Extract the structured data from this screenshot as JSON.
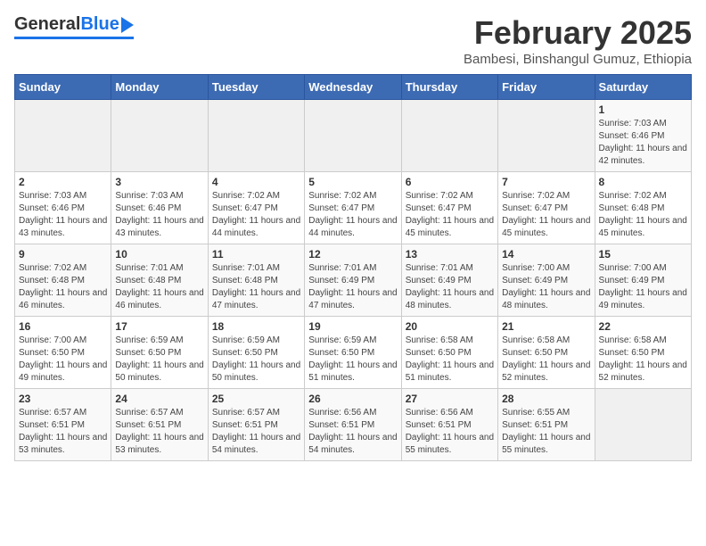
{
  "header": {
    "logo_general": "General",
    "logo_blue": "Blue",
    "month_title": "February 2025",
    "subtitle": "Bambesi, Binshangul Gumuz, Ethiopia"
  },
  "calendar": {
    "days_of_week": [
      "Sunday",
      "Monday",
      "Tuesday",
      "Wednesday",
      "Thursday",
      "Friday",
      "Saturday"
    ],
    "weeks": [
      {
        "row_bg": "odd",
        "days": [
          {
            "date": "",
            "info": "",
            "empty": true
          },
          {
            "date": "",
            "info": "",
            "empty": true
          },
          {
            "date": "",
            "info": "",
            "empty": true
          },
          {
            "date": "",
            "info": "",
            "empty": true
          },
          {
            "date": "",
            "info": "",
            "empty": true
          },
          {
            "date": "",
            "info": "",
            "empty": true
          },
          {
            "date": "1",
            "info": "Sunrise: 7:03 AM\nSunset: 6:46 PM\nDaylight: 11 hours and 42 minutes."
          }
        ]
      },
      {
        "row_bg": "even",
        "days": [
          {
            "date": "2",
            "info": "Sunrise: 7:03 AM\nSunset: 6:46 PM\nDaylight: 11 hours and 43 minutes."
          },
          {
            "date": "3",
            "info": "Sunrise: 7:03 AM\nSunset: 6:46 PM\nDaylight: 11 hours and 43 minutes."
          },
          {
            "date": "4",
            "info": "Sunrise: 7:02 AM\nSunset: 6:47 PM\nDaylight: 11 hours and 44 minutes."
          },
          {
            "date": "5",
            "info": "Sunrise: 7:02 AM\nSunset: 6:47 PM\nDaylight: 11 hours and 44 minutes."
          },
          {
            "date": "6",
            "info": "Sunrise: 7:02 AM\nSunset: 6:47 PM\nDaylight: 11 hours and 45 minutes."
          },
          {
            "date": "7",
            "info": "Sunrise: 7:02 AM\nSunset: 6:47 PM\nDaylight: 11 hours and 45 minutes."
          },
          {
            "date": "8",
            "info": "Sunrise: 7:02 AM\nSunset: 6:48 PM\nDaylight: 11 hours and 45 minutes."
          }
        ]
      },
      {
        "row_bg": "odd",
        "days": [
          {
            "date": "9",
            "info": "Sunrise: 7:02 AM\nSunset: 6:48 PM\nDaylight: 11 hours and 46 minutes."
          },
          {
            "date": "10",
            "info": "Sunrise: 7:01 AM\nSunset: 6:48 PM\nDaylight: 11 hours and 46 minutes."
          },
          {
            "date": "11",
            "info": "Sunrise: 7:01 AM\nSunset: 6:48 PM\nDaylight: 11 hours and 47 minutes."
          },
          {
            "date": "12",
            "info": "Sunrise: 7:01 AM\nSunset: 6:49 PM\nDaylight: 11 hours and 47 minutes."
          },
          {
            "date": "13",
            "info": "Sunrise: 7:01 AM\nSunset: 6:49 PM\nDaylight: 11 hours and 48 minutes."
          },
          {
            "date": "14",
            "info": "Sunrise: 7:00 AM\nSunset: 6:49 PM\nDaylight: 11 hours and 48 minutes."
          },
          {
            "date": "15",
            "info": "Sunrise: 7:00 AM\nSunset: 6:49 PM\nDaylight: 11 hours and 49 minutes."
          }
        ]
      },
      {
        "row_bg": "even",
        "days": [
          {
            "date": "16",
            "info": "Sunrise: 7:00 AM\nSunset: 6:50 PM\nDaylight: 11 hours and 49 minutes."
          },
          {
            "date": "17",
            "info": "Sunrise: 6:59 AM\nSunset: 6:50 PM\nDaylight: 11 hours and 50 minutes."
          },
          {
            "date": "18",
            "info": "Sunrise: 6:59 AM\nSunset: 6:50 PM\nDaylight: 11 hours and 50 minutes."
          },
          {
            "date": "19",
            "info": "Sunrise: 6:59 AM\nSunset: 6:50 PM\nDaylight: 11 hours and 51 minutes."
          },
          {
            "date": "20",
            "info": "Sunrise: 6:58 AM\nSunset: 6:50 PM\nDaylight: 11 hours and 51 minutes."
          },
          {
            "date": "21",
            "info": "Sunrise: 6:58 AM\nSunset: 6:50 PM\nDaylight: 11 hours and 52 minutes."
          },
          {
            "date": "22",
            "info": "Sunrise: 6:58 AM\nSunset: 6:50 PM\nDaylight: 11 hours and 52 minutes."
          }
        ]
      },
      {
        "row_bg": "odd",
        "days": [
          {
            "date": "23",
            "info": "Sunrise: 6:57 AM\nSunset: 6:51 PM\nDaylight: 11 hours and 53 minutes."
          },
          {
            "date": "24",
            "info": "Sunrise: 6:57 AM\nSunset: 6:51 PM\nDaylight: 11 hours and 53 minutes."
          },
          {
            "date": "25",
            "info": "Sunrise: 6:57 AM\nSunset: 6:51 PM\nDaylight: 11 hours and 54 minutes."
          },
          {
            "date": "26",
            "info": "Sunrise: 6:56 AM\nSunset: 6:51 PM\nDaylight: 11 hours and 54 minutes."
          },
          {
            "date": "27",
            "info": "Sunrise: 6:56 AM\nSunset: 6:51 PM\nDaylight: 11 hours and 55 minutes."
          },
          {
            "date": "28",
            "info": "Sunrise: 6:55 AM\nSunset: 6:51 PM\nDaylight: 11 hours and 55 minutes."
          },
          {
            "date": "",
            "info": "",
            "empty": true
          }
        ]
      }
    ]
  }
}
